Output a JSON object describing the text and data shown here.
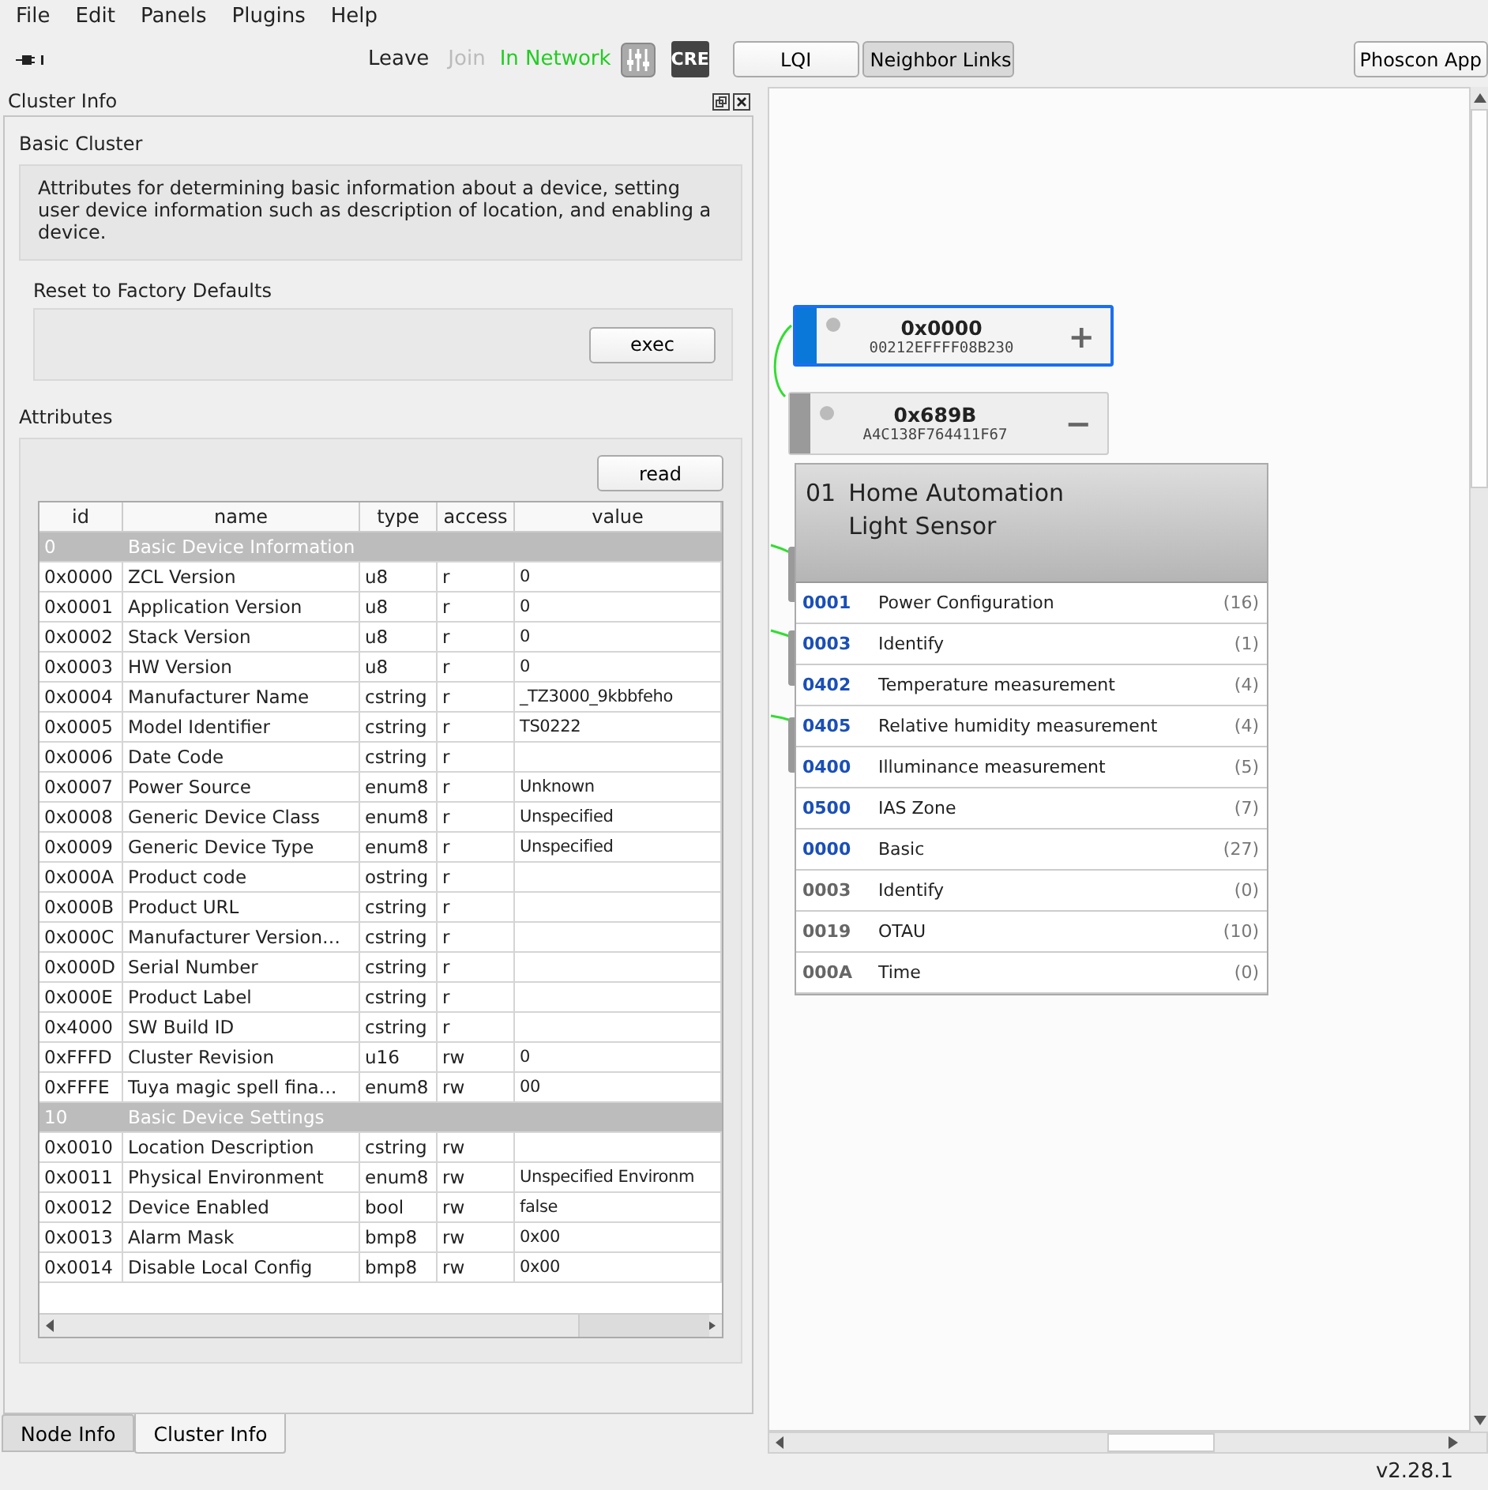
{
  "menu": [
    "File",
    "Edit",
    "Panels",
    "Plugins",
    "Help"
  ],
  "toolbar": {
    "leave": {
      "label": "Leave",
      "disabled": false
    },
    "join": {
      "label": "Join",
      "disabled": true
    },
    "status": "In Network",
    "cre": "CRE",
    "lqi": {
      "label": "LQI",
      "selected": false
    },
    "neighbor_links": {
      "label": "Neighbor Links",
      "selected": true
    },
    "phoscon": "Phoscon App"
  },
  "panel": {
    "title": "Cluster Info",
    "cluster_name": "Basic Cluster",
    "description": "Attributes for determining basic information about a device, setting user device information such as description of location, and enabling a device.",
    "reset": {
      "title": "Reset to Factory Defaults",
      "button": "exec"
    },
    "attributes": {
      "title": "Attributes",
      "read_button": "read",
      "columns": [
        "id",
        "name",
        "type",
        "access",
        "value"
      ],
      "rows": [
        {
          "kind": "group",
          "id": "0",
          "name": "Basic Device Information"
        },
        {
          "kind": "attr",
          "id": "0x0000",
          "name": "ZCL Version",
          "type": "u8",
          "access": "r",
          "value": "0"
        },
        {
          "kind": "attr",
          "id": "0x0001",
          "name": "Application Version",
          "type": "u8",
          "access": "r",
          "value": "0"
        },
        {
          "kind": "attr",
          "id": "0x0002",
          "name": "Stack Version",
          "type": "u8",
          "access": "r",
          "value": "0"
        },
        {
          "kind": "attr",
          "id": "0x0003",
          "name": "HW Version",
          "type": "u8",
          "access": "r",
          "value": "0"
        },
        {
          "kind": "attr",
          "id": "0x0004",
          "name": "Manufacturer Name",
          "type": "cstring",
          "access": "r",
          "value": "_TZ3000_9kbbfeho"
        },
        {
          "kind": "attr",
          "id": "0x0005",
          "name": "Model Identifier",
          "type": "cstring",
          "access": "r",
          "value": "TS0222"
        },
        {
          "kind": "attr",
          "id": "0x0006",
          "name": "Date Code",
          "type": "cstring",
          "access": "r"
        },
        {
          "kind": "attr",
          "id": "0x0007",
          "name": "Power Source",
          "type": "enum8",
          "access": "r",
          "value": "Unknown"
        },
        {
          "kind": "attr",
          "id": "0x0008",
          "name": "Generic Device Class",
          "type": "enum8",
          "access": "r",
          "value": "Unspecified"
        },
        {
          "kind": "attr",
          "id": "0x0009",
          "name": "Generic Device Type",
          "type": "enum8",
          "access": "r",
          "value": "Unspecified"
        },
        {
          "kind": "attr",
          "id": "0x000A",
          "name": "Product code",
          "type": "ostring",
          "access": "r"
        },
        {
          "kind": "attr",
          "id": "0x000B",
          "name": "Product URL",
          "type": "cstring",
          "access": "r"
        },
        {
          "kind": "attr",
          "id": "0x000C",
          "name": "Manufacturer Version…",
          "type": "cstring",
          "access": "r"
        },
        {
          "kind": "attr",
          "id": "0x000D",
          "name": "Serial Number",
          "type": "cstring",
          "access": "r"
        },
        {
          "kind": "attr",
          "id": "0x000E",
          "name": "Product Label",
          "type": "cstring",
          "access": "r"
        },
        {
          "kind": "attr",
          "id": "0x4000",
          "name": "SW Build ID",
          "type": "cstring",
          "access": "r"
        },
        {
          "kind": "attr",
          "id": "0xFFFD",
          "name": "Cluster Revision",
          "type": "u16",
          "access": "rw",
          "value": "0"
        },
        {
          "kind": "attr",
          "id": "0xFFFE",
          "name": "Tuya magic spell fina…",
          "type": "enum8",
          "access": "rw",
          "value": "00"
        },
        {
          "kind": "group",
          "id": "10",
          "name": "Basic Device Settings"
        },
        {
          "kind": "attr",
          "id": "0x0010",
          "name": "Location Description",
          "type": "cstring",
          "access": "rw"
        },
        {
          "kind": "attr",
          "id": "0x0011",
          "name": "Physical Environment",
          "type": "enum8",
          "access": "rw",
          "value": "Unspecified Environm"
        },
        {
          "kind": "attr",
          "id": "0x0012",
          "name": "Device Enabled",
          "type": "bool",
          "access": "rw",
          "value": "false"
        },
        {
          "kind": "attr",
          "id": "0x0013",
          "name": "Alarm Mask",
          "type": "bmp8",
          "access": "rw",
          "value": "0x00"
        },
        {
          "kind": "attr",
          "id": "0x0014",
          "name": "Disable Local Config",
          "type": "bmp8",
          "access": "rw",
          "value": "0x00"
        }
      ]
    }
  },
  "tabs": [
    {
      "label": "Node Info",
      "selected": false
    },
    {
      "label": "Cluster Info",
      "selected": true
    }
  ],
  "canvas": {
    "nodes": [
      {
        "address": "0x0000",
        "mac": "00212EFFFF08B230",
        "toggle": "+",
        "selected": true
      },
      {
        "address": "0x689B",
        "mac": "A4C138F764411F67",
        "toggle": "−",
        "selected": false
      }
    ],
    "endpoint": {
      "number": "01",
      "profile": "Home Automation",
      "device": "Light Sensor",
      "clusters": [
        {
          "id": "0001",
          "name": "Power Configuration",
          "count": "(16)",
          "color": "#1a4fb8"
        },
        {
          "id": "0003",
          "name": "Identify",
          "count": "(1)",
          "color": "#1a4fb8"
        },
        {
          "id": "0402",
          "name": "Temperature measurement",
          "count": "(4)",
          "color": "#1a4fb8"
        },
        {
          "id": "0405",
          "name": "Relative humidity measurement",
          "count": "(4)",
          "color": "#1a4fb8"
        },
        {
          "id": "0400",
          "name": "Illuminance measurement",
          "count": "(5)",
          "color": "#1a4fb8"
        },
        {
          "id": "0500",
          "name": "IAS Zone",
          "count": "(7)",
          "color": "#1a4fb8"
        },
        {
          "id": "0000",
          "name": "Basic",
          "count": "(27)",
          "color": "#1a4fb8"
        },
        {
          "id": "0003",
          "name": "Identify",
          "count": "(0)",
          "color": "#666666"
        },
        {
          "id": "0019",
          "name": "OTAU",
          "count": "(10)",
          "color": "#666666"
        },
        {
          "id": "000A",
          "name": "Time",
          "count": "(0)",
          "color": "#666666"
        }
      ]
    }
  },
  "status_bar": {
    "version": "v2.28.1"
  }
}
